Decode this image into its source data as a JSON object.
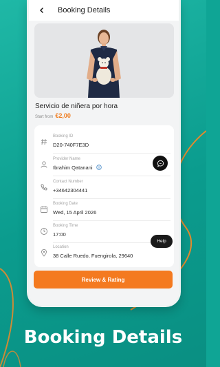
{
  "header": {
    "title": "Booking Details"
  },
  "service": {
    "name": "Servicio de niñera por hora",
    "price_prefix": "Start from",
    "price": "€2,00"
  },
  "details": [
    {
      "label": "Booking ID",
      "value": "D20-740F7E3D",
      "icon": "hash-icon"
    },
    {
      "label": "Provider Name",
      "value": "Ibrahim Qatanani",
      "icon": "person-icon"
    },
    {
      "label": "Contact Number",
      "value": "+34642304441",
      "icon": "phone-icon"
    },
    {
      "label": "Booking Date",
      "value": "Wed, 15 April 2026",
      "icon": "calendar-icon"
    },
    {
      "label": "Booking Time",
      "value": "17:00",
      "icon": "clock-icon"
    },
    {
      "label": "Location",
      "value": "38 Calle Ruedo, Fuengirola, 29640",
      "icon": "location-pin-icon"
    }
  ],
  "help_label": "Help",
  "cta_label": "Review & Rating",
  "caption": "Booking Details",
  "colors": {
    "accent": "#f47a20",
    "background": "#0fa595",
    "curve": "#e28a2e"
  }
}
